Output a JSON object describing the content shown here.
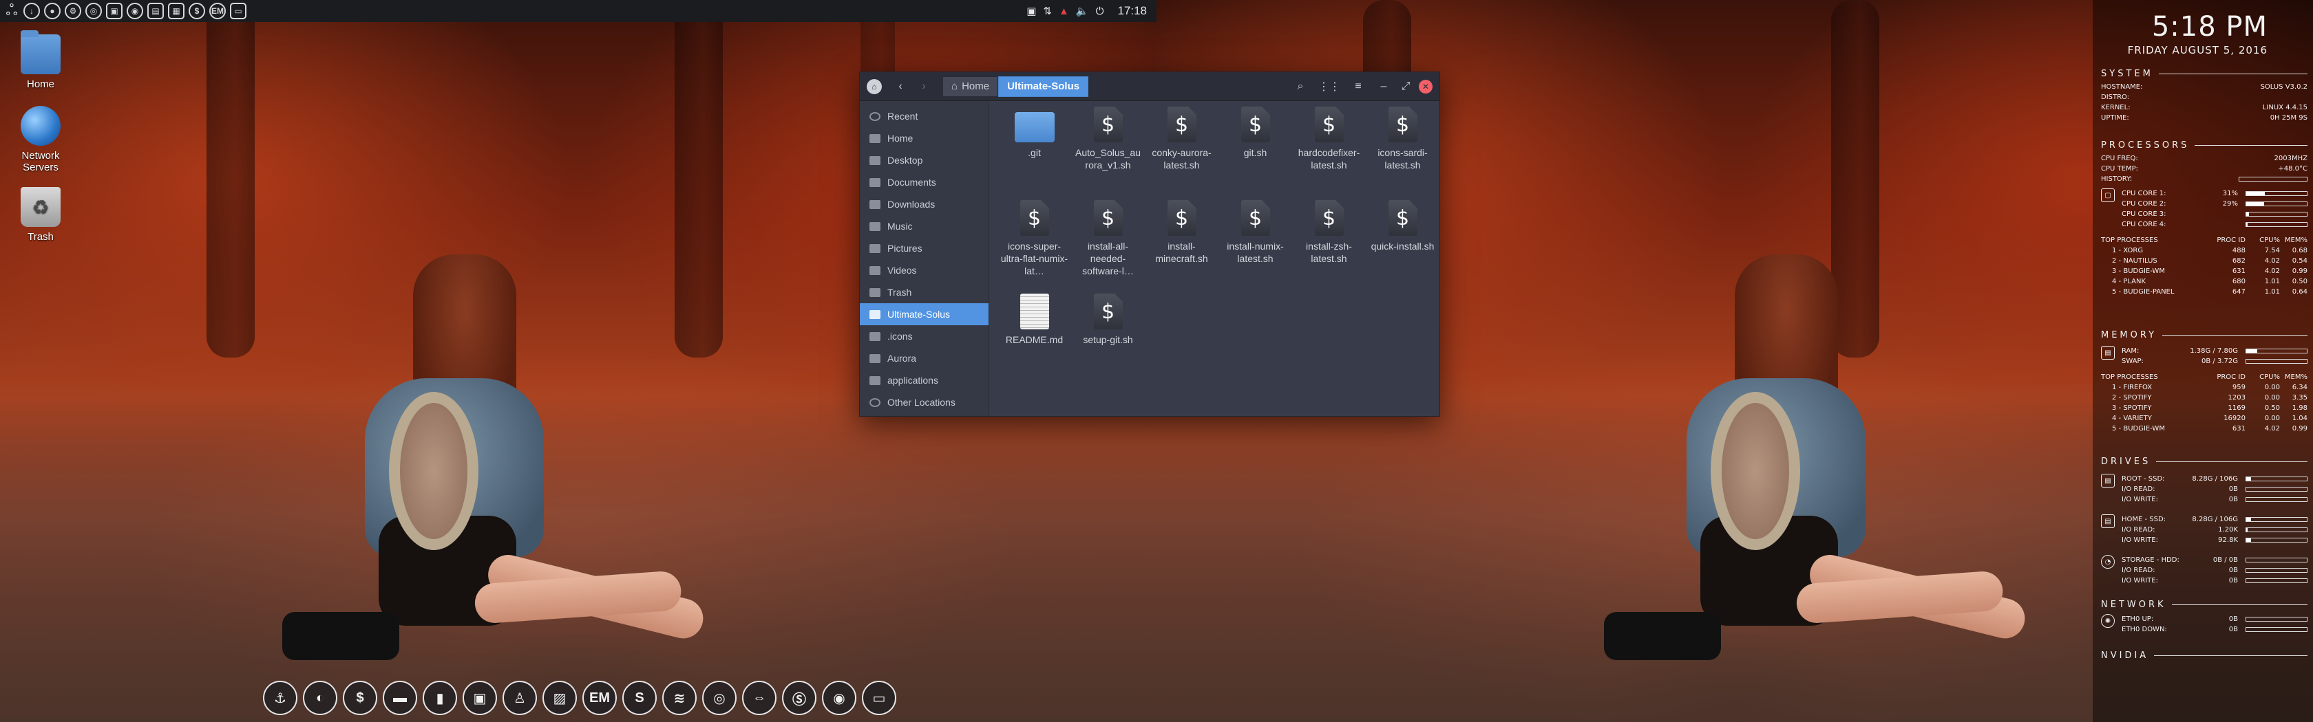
{
  "top_panel": {
    "clock": "17:18",
    "left_icons": [
      "gnome-foot-icon",
      "download-icon",
      "circle-icon",
      "settings-icon",
      "disk-icon",
      "terminal-icon",
      "media-icon",
      "terminal2-icon",
      "calendar-icon",
      "dollar-icon",
      "em-icon",
      "monitor-icon"
    ],
    "right_icons": [
      "screenshot-icon",
      "network-icon",
      "notification-icon",
      "volume-icon",
      "power-icon"
    ]
  },
  "desktop": {
    "icons": [
      {
        "label": "Home",
        "icon": "home-folder-icon"
      },
      {
        "label": "Network Servers",
        "icon": "network-globe-icon"
      },
      {
        "label": "Trash",
        "icon": "trash-icon"
      }
    ]
  },
  "file_manager": {
    "breadcrumbs": [
      "Home",
      "Ultimate-Solus"
    ],
    "sidebar": [
      {
        "label": "Recent",
        "icon": "clock-icon"
      },
      {
        "label": "Home",
        "icon": "home-icon"
      },
      {
        "label": "Desktop",
        "icon": "folder-icon"
      },
      {
        "label": "Documents",
        "icon": "folder-icon"
      },
      {
        "label": "Downloads",
        "icon": "download-icon"
      },
      {
        "label": "Music",
        "icon": "music-icon"
      },
      {
        "label": "Pictures",
        "icon": "folder-icon"
      },
      {
        "label": "Videos",
        "icon": "video-icon"
      },
      {
        "label": "Trash",
        "icon": "trash-icon"
      },
      {
        "label": "Ultimate-Solus",
        "icon": "folder-icon",
        "selected": true
      },
      {
        "label": ".icons",
        "icon": "folder-icon"
      },
      {
        "label": "Aurora",
        "icon": "folder-icon"
      },
      {
        "label": "applications",
        "icon": "folder-icon"
      },
      {
        "label": "Other Locations",
        "icon": "plus-icon"
      }
    ],
    "files": [
      {
        "name": ".git",
        "type": "folder"
      },
      {
        "name": "Auto_Solus_aurora_v1.sh",
        "type": "script"
      },
      {
        "name": "conky-aurora-latest.sh",
        "type": "script"
      },
      {
        "name": "git.sh",
        "type": "script"
      },
      {
        "name": "hardcodefixer-latest.sh",
        "type": "script"
      },
      {
        "name": "icons-sardi-latest.sh",
        "type": "script"
      },
      {
        "name": "icons-super-ultra-flat-numix-lat…",
        "type": "script"
      },
      {
        "name": "install-all-needed-software-l…",
        "type": "script"
      },
      {
        "name": "install-minecraft.sh",
        "type": "script"
      },
      {
        "name": "install-numix-latest.sh",
        "type": "script"
      },
      {
        "name": "install-zsh-latest.sh",
        "type": "script"
      },
      {
        "name": "quick-install.sh",
        "type": "script"
      },
      {
        "name": "README.md",
        "type": "text"
      },
      {
        "name": "setup-git.sh",
        "type": "script"
      }
    ]
  },
  "dock": {
    "items": [
      "anchor-icon",
      "firefox-swirl-icon",
      "dollar-icon",
      "folder-drive-icon",
      "files-icon",
      "drive-icon",
      "person-icon",
      "image-icon",
      "em-icon",
      "skype-s-icon",
      "wifi-icon",
      "chrome-icon",
      "arrows-icon",
      "skype-icon",
      "world-icon",
      "monitor-icon"
    ]
  },
  "conky": {
    "clock": "5:18 PM",
    "date": "FRIDAY AUGUST 5, 2016",
    "system": {
      "title": "SYSTEM",
      "rows": [
        {
          "label": "HOSTNAME:",
          "value": "SOLUS V3.0.2"
        },
        {
          "label": "DISTRO:",
          "value": ""
        },
        {
          "label": "KERNEL:",
          "value": "LINUX 4.4.15"
        },
        {
          "label": "UPTIME:",
          "value": "0H 25M 9S"
        }
      ]
    },
    "processors": {
      "title": "PROCESSORS",
      "rows": [
        {
          "label": "CPU FREQ:",
          "value": "2003MHZ"
        },
        {
          "label": "CPU TEMP:",
          "value": "+48.0°C"
        },
        {
          "label": "HISTORY:",
          "value": ""
        }
      ],
      "cores": [
        {
          "label": "CPU CORE 1:",
          "value": "31%",
          "level": 31
        },
        {
          "label": "CPU CORE 2:",
          "value": "29%",
          "level": 29
        },
        {
          "label": "CPU CORE 3:",
          "value": "",
          "level": 4
        },
        {
          "label": "CPU CORE 4:",
          "value": "",
          "level": 2
        }
      ],
      "table_header": [
        "TOP PROCESSES",
        "PROC ID",
        "CPU%",
        "MEM%"
      ],
      "table": [
        [
          "1 - XORG",
          "488",
          "7.54",
          "0.68"
        ],
        [
          "2 - NAUTILUS",
          "682",
          "4.02",
          "0.54"
        ],
        [
          "3 - BUDGIE-WM",
          "631",
          "4.02",
          "0.99"
        ],
        [
          "4 - PLANK",
          "680",
          "1.01",
          "0.50"
        ],
        [
          "5 - BUDGIE-PANEL",
          "647",
          "1.01",
          "0.64"
        ]
      ]
    },
    "memory": {
      "title": "MEMORY",
      "rows": [
        {
          "label": "RAM:",
          "value": "1.38G / 7.80G",
          "level": 18
        },
        {
          "label": "SWAP:",
          "value": "0B / 3.72G",
          "level": 0
        }
      ],
      "table_header": [
        "TOP PROCESSES",
        "PROC ID",
        "CPU%",
        "MEM%"
      ],
      "table": [
        [
          "1 - FIREFOX",
          "959",
          "0.00",
          "6.34"
        ],
        [
          "2 - SPOTIFY",
          "1203",
          "0.00",
          "3.35"
        ],
        [
          "3 - SPOTIFY",
          "1169",
          "0.50",
          "1.98"
        ],
        [
          "4 - VARIETY",
          "16920",
          "0.00",
          "1.04"
        ],
        [
          "5 - BUDGIE-WM",
          "631",
          "4.02",
          "0.99"
        ]
      ]
    },
    "drives": {
      "title": "DRIVES",
      "groups": [
        {
          "rows": [
            {
              "label": "ROOT - SSD:",
              "value": "8.28G / 106G",
              "level": 8
            },
            {
              "label": "I/O READ:",
              "value": "0B",
              "level": 0
            },
            {
              "label": "I/O WRITE:",
              "value": "0B",
              "level": 0
            }
          ]
        },
        {
          "rows": [
            {
              "label": "HOME - SSD:",
              "value": "8.28G / 106G",
              "level": 8
            },
            {
              "label": "I/O READ:",
              "value": "1.20K",
              "level": 2
            },
            {
              "label": "I/O WRITE:",
              "value": "92.8K",
              "level": 8
            }
          ]
        },
        {
          "rows": [
            {
              "label": "STORAGE - HDD:",
              "value": "0B / 0B",
              "level": 0
            },
            {
              "label": "I/O READ:",
              "value": "0B",
              "level": 0
            },
            {
              "label": "I/O WRITE:",
              "value": "0B",
              "level": 0
            }
          ]
        }
      ]
    },
    "network": {
      "title": "NETWORK",
      "rows": [
        {
          "label": "ETH0 UP:",
          "value": "0B",
          "level": 0
        },
        {
          "label": "ETH0 DOWN:",
          "value": "0B",
          "level": 0
        }
      ]
    },
    "nvidia": {
      "title": "NVIDIA"
    }
  }
}
